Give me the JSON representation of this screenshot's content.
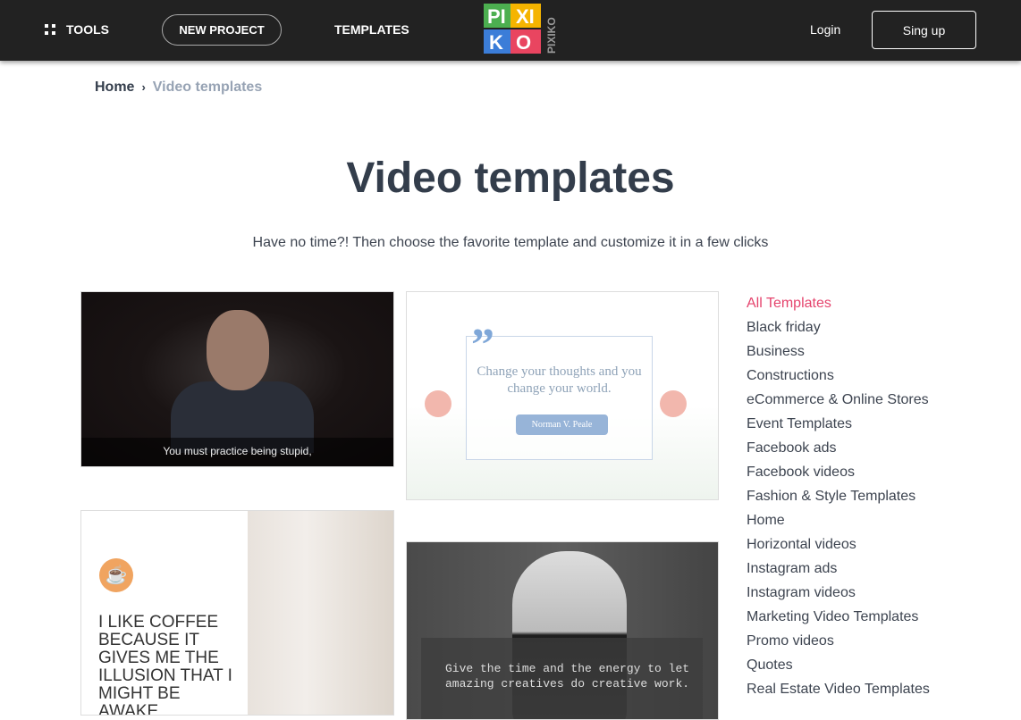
{
  "header": {
    "tools": "TOOLS",
    "new_project": "NEW PROJECT",
    "templates": "TEMPLATES",
    "logo": "PIXIKO",
    "login": "Login",
    "signup": "Sing up"
  },
  "breadcrumb": {
    "home": "Home",
    "separator": "›",
    "current": "Video templates"
  },
  "page": {
    "title": "Video templates",
    "subtitle": "Have no time?! Then choose the favorite template and customize it in a few clicks"
  },
  "cards": [
    {
      "caption": "You must practice being stupid,"
    },
    {
      "quote": "Change your thoughts and you change your world.",
      "author": "Norman V. Peale"
    },
    {
      "text": "I LIKE COFFEE BECAUSE IT GIVES ME THE ILLUSION THAT I MIGHT BE AWAKE"
    },
    {
      "text": "Give the time and the energy to let amazing creatives do creative work."
    }
  ],
  "categories": [
    "All Templates",
    "Black friday",
    "Business",
    "Constructions",
    "eCommerce & Online Stores",
    "Event Templates",
    "Facebook ads",
    "Facebook videos",
    "Fashion & Style Templates",
    "Home",
    "Horizontal videos",
    "Instagram ads",
    "Instagram videos",
    "Marketing Video Templates",
    "Promo videos",
    "Quotes",
    "Real Estate Video Templates"
  ],
  "colors": {
    "accent": "#e5446d",
    "header_bg": "#222222"
  }
}
